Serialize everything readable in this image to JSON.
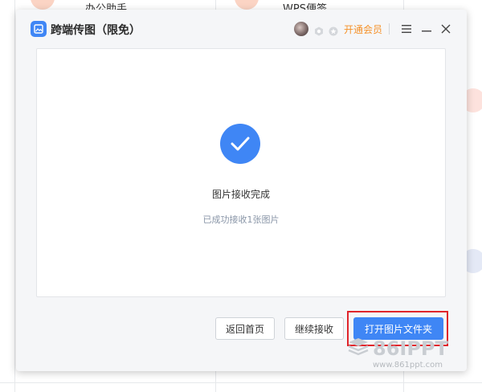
{
  "background_app": {
    "card_left_label": "办公助手",
    "card_right_label": "WPS便签"
  },
  "dialog": {
    "title": "跨端传图（限免）",
    "vip_label": "开通会员",
    "status_title": "图片接收完成",
    "status_subtitle": "已成功接收1张图片",
    "buttons": {
      "back_home": "返回首页",
      "continue_receive": "继续接收",
      "open_folder": "打开图片文件夹"
    }
  },
  "colors": {
    "accent": "#3f86f5",
    "vip": "#f5922a",
    "highlight_box": "#e0252b"
  },
  "watermark": {
    "brand": "86IPPT",
    "url": "www.861ppt.com"
  }
}
